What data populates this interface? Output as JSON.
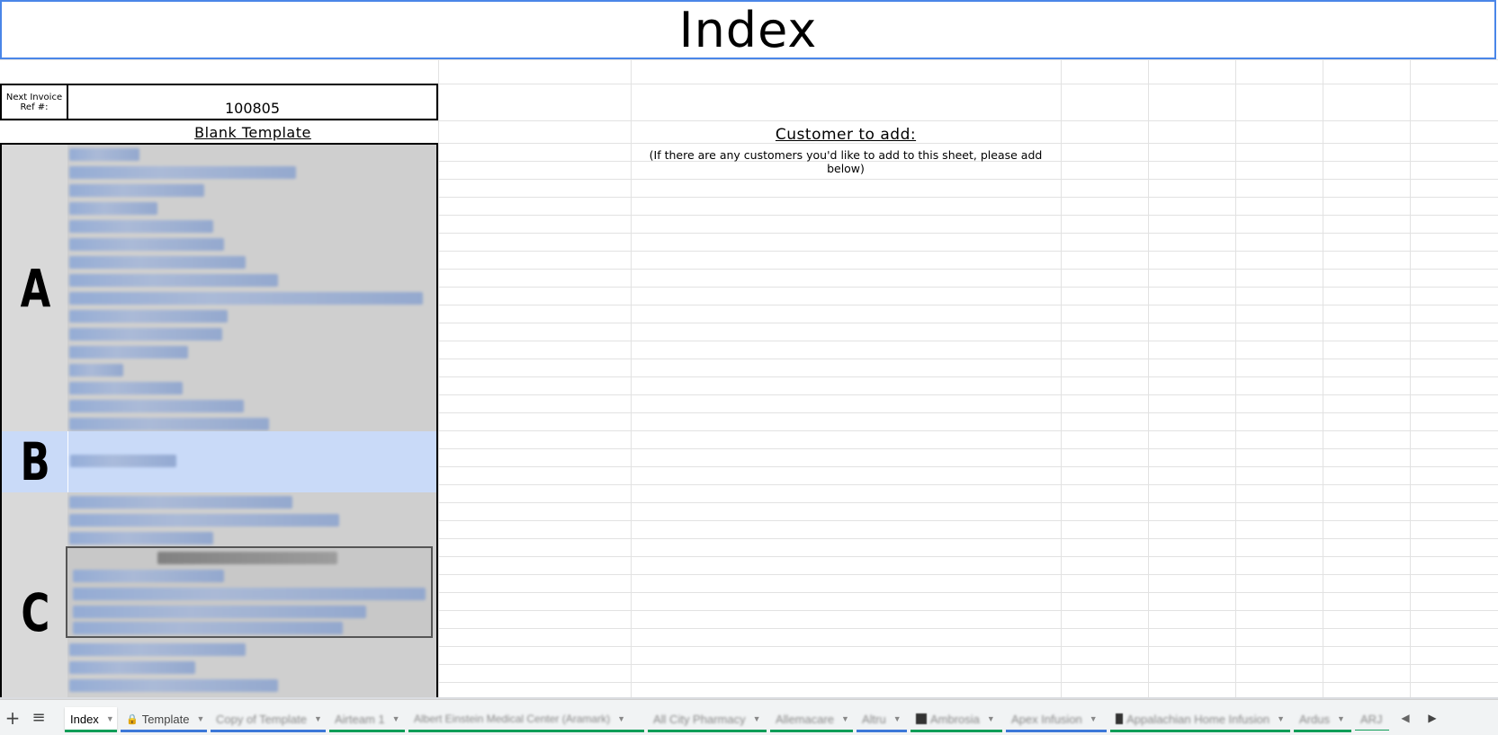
{
  "title": "Index",
  "invoice": {
    "label": "Next Invoice Ref #:",
    "value": "100805"
  },
  "blank_template": "Blank Template",
  "customer_add": {
    "heading": "Customer to add:",
    "note": "(If there are any customers you'd like to add to this sheet, please add below)"
  },
  "sections": [
    {
      "letter": "A",
      "item_count": 16
    },
    {
      "letter": "B",
      "item_count": 1
    },
    {
      "letter": "C",
      "item_count": 10
    }
  ],
  "tabs": [
    {
      "label": "Index",
      "active": true,
      "color": "#0f9d58"
    },
    {
      "label": "Template",
      "locked": true,
      "color": "#3c78d8"
    },
    {
      "label": "Copy of Template",
      "color": "#3c78d8"
    },
    {
      "label": "Airteam 1",
      "color": "#0f9d58"
    },
    {
      "label": "Albert Einstein Medical Center (Aramark)",
      "color": "#0f9d58"
    },
    {
      "label": "All City Pharmacy",
      "color": "#0f9d58"
    },
    {
      "label": "Allemacare",
      "color": "#0f9d58"
    },
    {
      "label": "Altru",
      "color": "#3c78d8"
    },
    {
      "label": "Ambrosia",
      "color": "#0f9d58"
    },
    {
      "label": "Apex Infusion",
      "color": "#3c78d8"
    },
    {
      "label": "Appalachian Home Infusion",
      "color": "#0f9d58"
    },
    {
      "label": "Ardus",
      "color": "#0f9d58"
    },
    {
      "label": "ARJ",
      "color": "#0f9d58"
    }
  ],
  "icons": {
    "add_sheet": "plus-icon",
    "all_sheets": "menu-icon",
    "prev": "chevron-left-icon",
    "next": "chevron-right-icon"
  }
}
